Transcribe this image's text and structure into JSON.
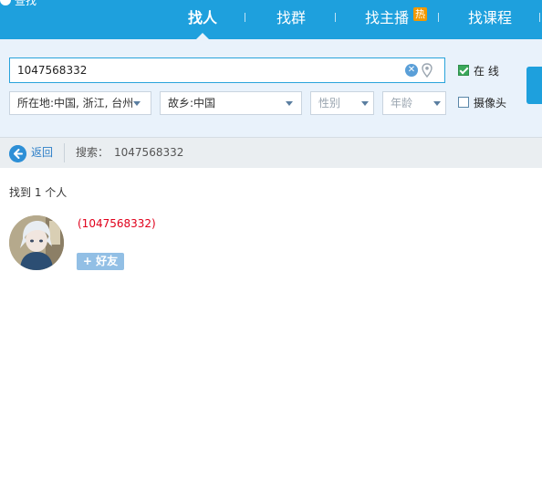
{
  "corner_label": "查找",
  "tabs": [
    {
      "label": "找人",
      "active": true
    },
    {
      "label": "找群",
      "active": false
    },
    {
      "label": "找主播",
      "active": false,
      "badge": "热"
    },
    {
      "label": "找课程",
      "active": false
    }
  ],
  "search": {
    "value": "1047568332",
    "filters": {
      "location": "所在地:中国, 浙江, 台州",
      "hometown": "故乡:中国",
      "gender_placeholder": "性别",
      "age_placeholder": "年龄"
    },
    "online_label": "在  线",
    "online_checked": true,
    "camera_label": "摄像头",
    "camera_checked": false
  },
  "breadcrumb": {
    "back_label": "返回",
    "search_label": "搜索：",
    "query": "1047568332"
  },
  "results": {
    "count_text": "找到 1 个人",
    "items": [
      {
        "id_text": "(1047568332)",
        "add_label": "+ 好友"
      }
    ]
  },
  "colors": {
    "accent": "#1ea0dd",
    "panel_bg": "#e9f2fb",
    "id_red": "#e0001b",
    "add_button": "#92bfe5"
  },
  "icons": [
    "clear-icon",
    "location-pin-icon",
    "back-arrow-icon",
    "user-avatar"
  ]
}
